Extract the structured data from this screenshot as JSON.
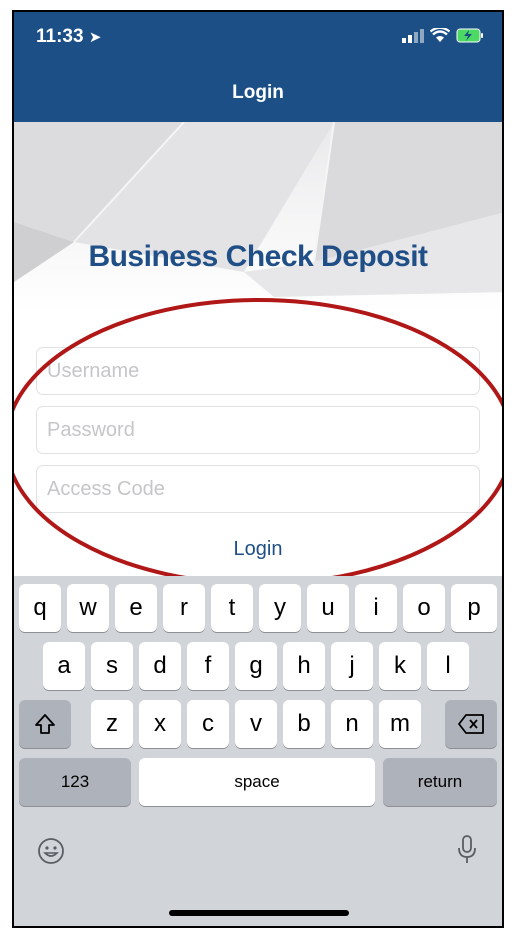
{
  "status_bar": {
    "time": "11:33"
  },
  "nav": {
    "title": "Login"
  },
  "brand": {
    "name": "Business Check Deposit"
  },
  "form": {
    "username": {
      "placeholder": "Username"
    },
    "password": {
      "placeholder": "Password"
    },
    "access_code": {
      "placeholder": "Access Code"
    },
    "login_label": "Login"
  },
  "keyboard": {
    "row1": [
      "q",
      "w",
      "e",
      "r",
      "t",
      "y",
      "u",
      "i",
      "o",
      "p"
    ],
    "row2": [
      "a",
      "s",
      "d",
      "f",
      "g",
      "h",
      "j",
      "k",
      "l"
    ],
    "row3": [
      "z",
      "x",
      "c",
      "v",
      "b",
      "n",
      "m"
    ],
    "numbers_label": "123",
    "space_label": "space",
    "return_label": "return"
  },
  "colors": {
    "brand_blue": "#1c4f86",
    "annotation_red": "#b01818",
    "keyboard_bg": "#d1d4d9"
  },
  "icons": [
    "location-arrow-icon",
    "signal-icon",
    "wifi-icon",
    "battery-charging-icon",
    "shift-icon",
    "backspace-icon",
    "emoji-icon",
    "microphone-icon"
  ]
}
